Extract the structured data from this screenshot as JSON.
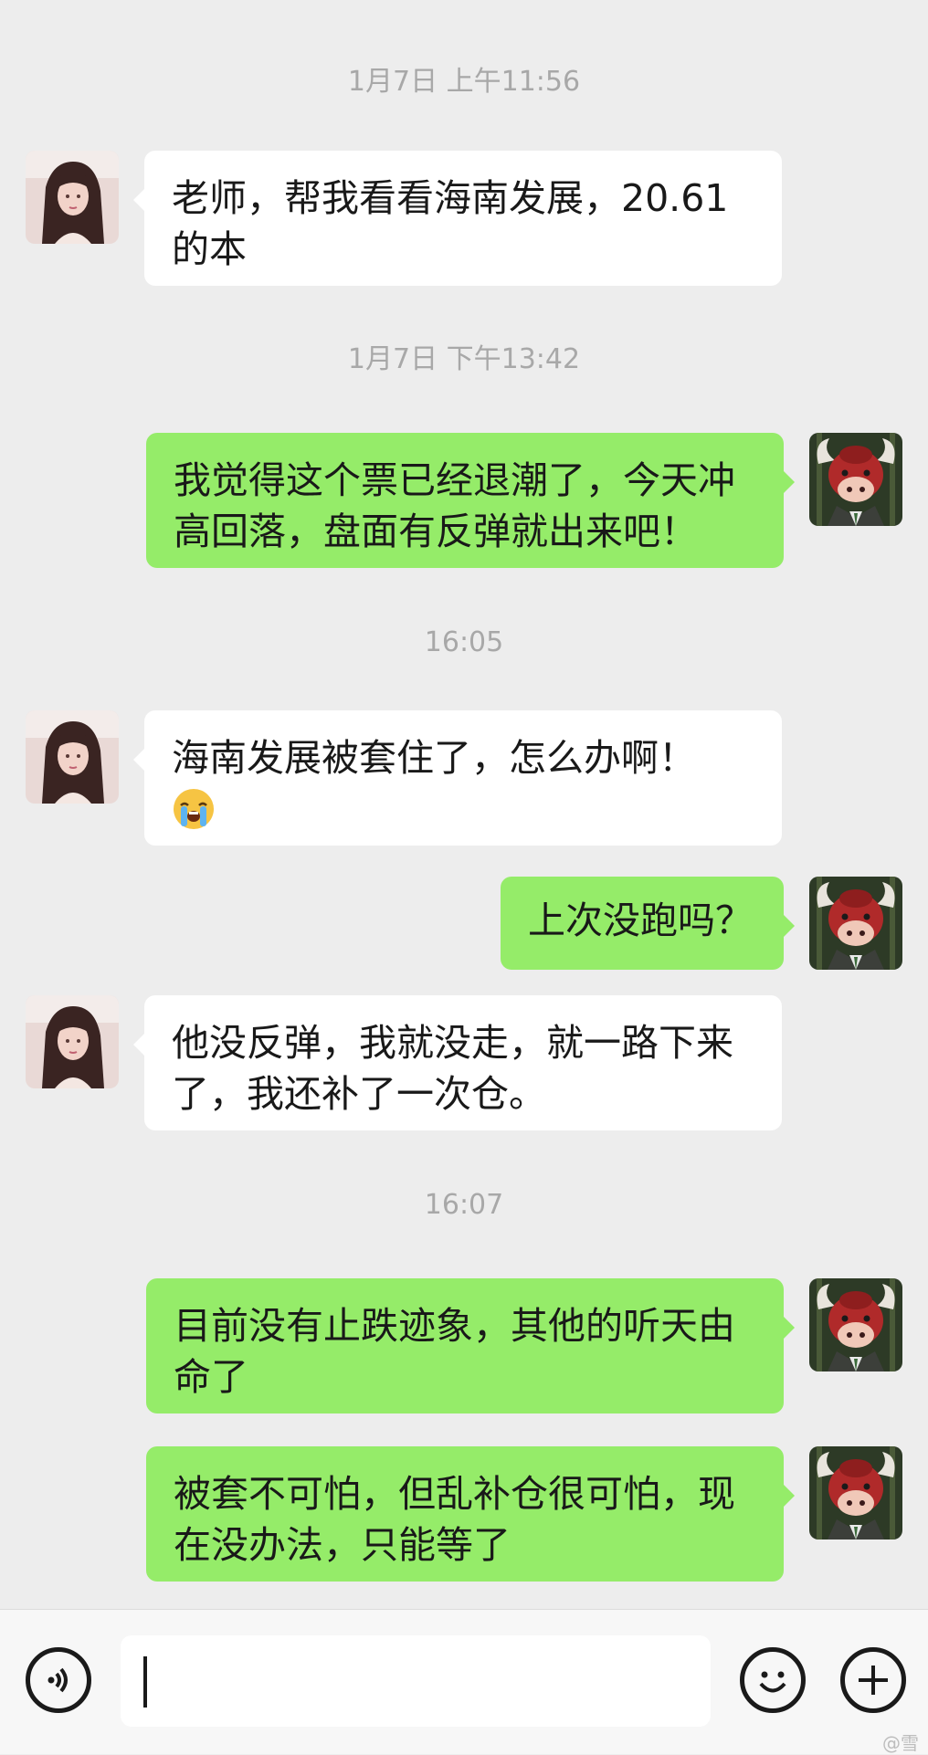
{
  "timestamps": [
    "1月7日 上午11:56",
    "1月7日 下午13:42",
    "16:05",
    "16:07"
  ],
  "messages": [
    {
      "sender": "user",
      "text": "老师，帮我看看海南发展，20.61\n的本"
    },
    {
      "sender": "teacher",
      "text": "我觉得这个票已经退潮了，今天冲\n高回落，盘面有反弹就出来吧！"
    },
    {
      "sender": "user",
      "text": "海南发展被套住了，怎么办啊！",
      "emoji": "loudly-crying-face"
    },
    {
      "sender": "teacher",
      "text": "上次没跑吗？"
    },
    {
      "sender": "user",
      "text": "他没反弹，我就没走，就一路下来\n了，我还补了一次仓。"
    },
    {
      "sender": "teacher",
      "text": "目前没有止跌迹象，其他的听天由\n命了"
    },
    {
      "sender": "teacher",
      "text": "被套不可怕，但乱补仓很可怕，现\n在没办法，只能等了"
    }
  ],
  "input_bar": {
    "voice_icon": "voice-icon",
    "emoji_icon": "emoji-icon",
    "add_icon": "add-icon",
    "value": "",
    "watermark": "@雪"
  },
  "colors": {
    "background": "#ededed",
    "sent_bubble": "#95ec69",
    "received_bubble": "#ffffff",
    "timestamp": "#a8a8a8"
  }
}
